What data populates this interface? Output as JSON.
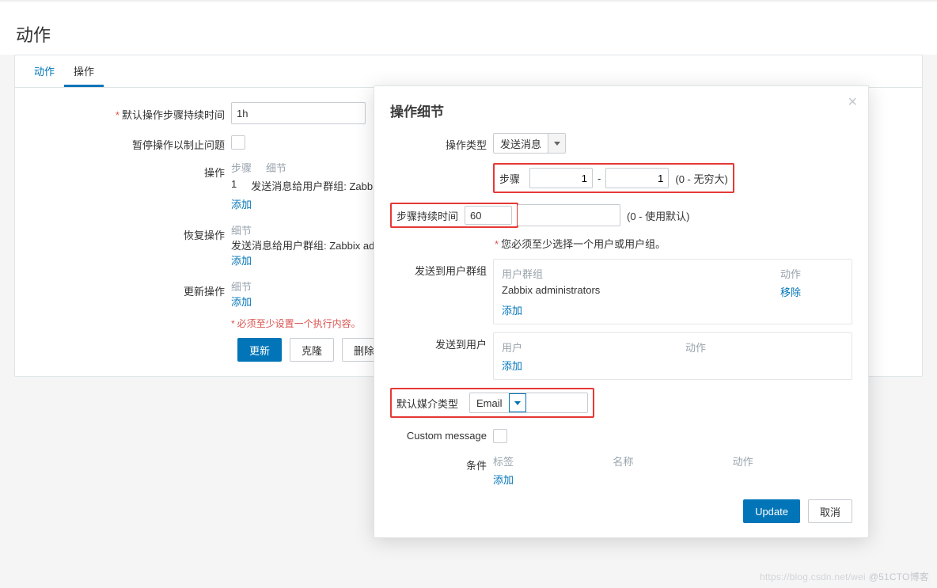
{
  "page": {
    "title": "动作"
  },
  "tabs": {
    "action": "动作",
    "operation": "操作"
  },
  "form": {
    "default_duration_label": "默认操作步骤持续时间",
    "default_duration_value": "1h",
    "pause_label": "暂停操作以制止问题",
    "ops_label": "操作",
    "ops_step_header": "步骤",
    "ops_detail_header": "细节",
    "ops_step_value": "1",
    "ops_detail_value": "发送消息给用户群组: Zabbi",
    "add": "添加",
    "recovery_label": "恢复操作",
    "recovery_detail_header": "细节",
    "recovery_detail_value": "发送消息给用户群组: Zabbix adm",
    "update_label": "更新操作",
    "update_detail_header": "细节",
    "required_note": "必须至少设置一个执行内容。",
    "btn_update": "更新",
    "btn_clone": "克隆",
    "btn_delete": "删除"
  },
  "modal": {
    "title": "操作细节",
    "lbl_op_type": "操作类型",
    "op_type_value": "发送消息",
    "lbl_steps": "步骤",
    "step_from": "1",
    "step_to": "1",
    "step_suffix": "(0 - 无穷大)",
    "lbl_step_duration": "步骤持续时间",
    "step_duration_value": "60",
    "step_dur_suffix": "(0 - 使用默认)",
    "must_select_note": "您必须至少选择一个用户或用户组。",
    "lbl_send_groups": "发送到用户群组",
    "groups_col1": "用户群组",
    "groups_col2": "动作",
    "group_row_name": "Zabbix administrators",
    "group_row_action": "移除",
    "lbl_send_users": "发送到用户",
    "users_col1": "用户",
    "users_col2": "动作",
    "lbl_media_type": "默认媒介类型",
    "media_value": "Email",
    "lbl_custom_msg": "Custom message",
    "lbl_conditions": "条件",
    "cond_col1": "标签",
    "cond_col2": "名称",
    "cond_col3": "动作",
    "btn_update": "Update",
    "btn_cancel": "取消"
  },
  "watermark": {
    "faint": "https://blog.csdn.net/wei",
    "strong": "@51CTO博客"
  }
}
